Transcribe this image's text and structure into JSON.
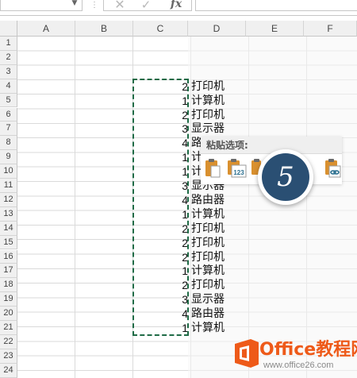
{
  "formula_bar": {
    "separator": "⋮",
    "cancel_glyph": "✕",
    "enter_glyph": "✓",
    "fx_label": "fx"
  },
  "columns": [
    "A",
    "B",
    "C",
    "D",
    "E",
    "F"
  ],
  "rows": [
    "1",
    "2",
    "3",
    "4",
    "5",
    "6",
    "7",
    "8",
    "9",
    "10",
    "11",
    "12",
    "13",
    "14",
    "15",
    "16",
    "17",
    "18",
    "19",
    "20",
    "21",
    "22",
    "23",
    "24"
  ],
  "cells": [
    {
      "row": "4",
      "c": "2",
      "d": "打印机"
    },
    {
      "row": "5",
      "c": "1",
      "d": "计算机"
    },
    {
      "row": "6",
      "c": "2",
      "d": "打印机"
    },
    {
      "row": "7",
      "c": "3",
      "d": "显示器"
    },
    {
      "row": "8",
      "c": "4",
      "d": "路"
    },
    {
      "row": "9",
      "c": "1",
      "d": "计"
    },
    {
      "row": "10",
      "c": "1",
      "d": "计"
    },
    {
      "row": "11",
      "c": "3",
      "d": "显示器"
    },
    {
      "row": "12",
      "c": "4",
      "d": "路由器"
    },
    {
      "row": "13",
      "c": "1",
      "d": "计算机"
    },
    {
      "row": "14",
      "c": "2",
      "d": "打印机"
    },
    {
      "row": "15",
      "c": "2",
      "d": "打印机"
    },
    {
      "row": "16",
      "c": "2",
      "d": "打印机"
    },
    {
      "row": "17",
      "c": "1",
      "d": "计算机"
    },
    {
      "row": "18",
      "c": "2",
      "d": "打印机"
    },
    {
      "row": "19",
      "c": "3",
      "d": "显示器"
    },
    {
      "row": "20",
      "c": "4",
      "d": "路由器"
    },
    {
      "row": "21",
      "c": "1",
      "d": "计算机"
    }
  ],
  "paste_options": {
    "title": "粘贴选项:",
    "values_badge": "123",
    "icons": [
      "paste-icon",
      "paste-values-icon",
      "paste-formulas-icon",
      "paste-link-icon"
    ]
  },
  "step_badge": "5",
  "watermark": {
    "title": "Office教程网",
    "url": "www.office26.com"
  },
  "colors": {
    "marquee": "#1f6b46",
    "badge": "#2a4f73",
    "watermark_orange": "#ee5a19",
    "clipboard_orange": "#d9902f",
    "clipboard_teal": "#2a6f8f"
  }
}
